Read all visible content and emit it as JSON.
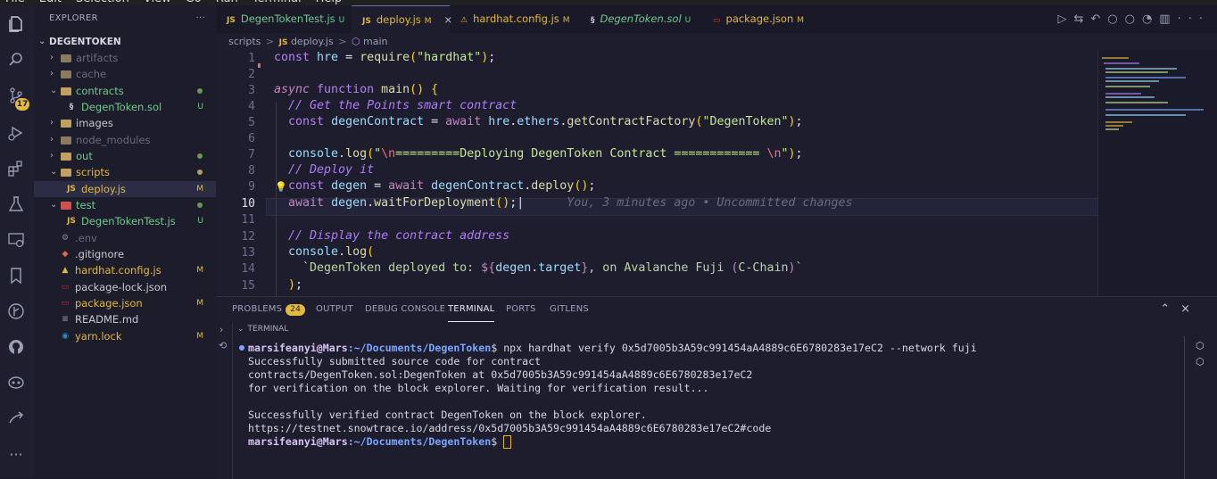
{
  "menu": [
    "File",
    "Edit",
    "Selection",
    "View",
    "Go",
    "Run",
    "Terminal",
    "Help"
  ],
  "activity": {
    "source_control_badge": "17",
    "icons": [
      "files-icon",
      "search-icon",
      "source-control-icon",
      "run-debug-icon",
      "extensions-icon",
      "testing-icon",
      "remote-explorer-icon",
      "bookmarks-icon",
      "gitlens-icon",
      "github-icon",
      "copilot-icon",
      "deploy-icon",
      "more-icon"
    ]
  },
  "explorer": {
    "title": "EXPLORER",
    "more": "···",
    "project": "DEGENTOKEN",
    "items": [
      {
        "label": "artifacts",
        "indent": 1,
        "type": "folder",
        "open": false,
        "status": "",
        "color": "#6b6b80"
      },
      {
        "label": "cache",
        "indent": 1,
        "type": "folder",
        "open": false,
        "status": "",
        "color": "#6b6b80"
      },
      {
        "label": "contracts",
        "indent": 1,
        "type": "folder",
        "open": true,
        "status": "dot",
        "color": "#73c991"
      },
      {
        "label": "DegenToken.sol",
        "indent": 2,
        "type": "sol",
        "status": "U",
        "color": "#73c991"
      },
      {
        "label": "images",
        "indent": 1,
        "type": "folder",
        "open": false,
        "status": "",
        "color": "#c8c8d0"
      },
      {
        "label": "node_modules",
        "indent": 1,
        "type": "folder",
        "open": false,
        "status": "",
        "color": "#6b6b80"
      },
      {
        "label": "out",
        "indent": 1,
        "type": "folder",
        "open": false,
        "status": "dot",
        "color": "#73c991"
      },
      {
        "label": "scripts",
        "indent": 1,
        "type": "folder",
        "open": true,
        "status": "dot",
        "color": "#e2b93d"
      },
      {
        "label": "deploy.js",
        "indent": 2,
        "type": "js",
        "status": "M",
        "color": "#e2b93d",
        "selected": true
      },
      {
        "label": "test",
        "indent": 1,
        "type": "folder",
        "open": true,
        "status": "dot",
        "color": "#73c991"
      },
      {
        "label": "DegenTokenTest.js",
        "indent": 2,
        "type": "js",
        "status": "U",
        "color": "#73c991"
      },
      {
        "label": ".env",
        "indent": 1,
        "type": "env",
        "status": "",
        "color": "#6b6b80"
      },
      {
        "label": ".gitignore",
        "indent": 1,
        "type": "git",
        "status": "",
        "color": "#c8c8d0"
      },
      {
        "label": "hardhat.config.js",
        "indent": 1,
        "type": "hardhat",
        "status": "M",
        "color": "#e2b93d"
      },
      {
        "label": "package-lock.json",
        "indent": 1,
        "type": "npm",
        "status": "",
        "color": "#c8c8d0"
      },
      {
        "label": "package.json",
        "indent": 1,
        "type": "npm",
        "status": "M",
        "color": "#e2b93d"
      },
      {
        "label": "README.md",
        "indent": 1,
        "type": "md",
        "status": "",
        "color": "#c8c8d0"
      },
      {
        "label": "yarn.lock",
        "indent": 1,
        "type": "yarn",
        "status": "M",
        "color": "#e2b93d"
      }
    ]
  },
  "tabs": [
    {
      "label": "DegenTokenTest.js",
      "status": "U",
      "icon": "JS",
      "color": "#73c991",
      "active": false
    },
    {
      "label": "deploy.js",
      "status": "M",
      "icon": "JS",
      "color": "#e2b93d",
      "active": true,
      "close": "×"
    },
    {
      "label": "hardhat.config.js",
      "status": "M",
      "icon": "⚠",
      "color": "#e2b93d",
      "active": false
    },
    {
      "label": "DegenToken.sol",
      "status": "U",
      "icon": "sol",
      "color": "#73c991",
      "active": false,
      "italic": true
    },
    {
      "label": "package.json",
      "status": "M",
      "icon": "npm",
      "color": "#e2b93d",
      "active": false
    }
  ],
  "breadcrumb": {
    "folder": "scripts",
    "file": "deploy.js",
    "symbol": "main",
    "sep": ">"
  },
  "editor": {
    "line_numbers": [
      "1",
      "2",
      "3",
      "4",
      "5",
      "6",
      "7",
      "8",
      "9",
      "10",
      "11",
      "12",
      "13",
      "14",
      "15"
    ],
    "current_line": "10",
    "blame": "You, 3 minutes ago • Uncommitted changes"
  },
  "panel": {
    "tabs": [
      "PROBLEMS",
      "OUTPUT",
      "DEBUG CONSOLE",
      "TERMINAL",
      "PORTS",
      "GITLENS"
    ],
    "problems_count": "24",
    "active_tab": "TERMINAL",
    "terminal_header": "TERMINAL",
    "prompt_user": "marsifeanyi@Mars",
    "prompt_path": ":~/Documents/DegenToken",
    "prompt_symbol": "$",
    "command": " npx hardhat verify 0x5d7005b3A59c991454aA4889c6E6780283e17eC2 --network fuji",
    "output": [
      "Successfully submitted source code for contract",
      "contracts/DegenToken.sol:DegenToken at 0x5d7005b3A59c991454aA4889c6E6780283e17eC2",
      "for verification on the block explorer. Waiting for verification result...",
      "",
      "Successfully verified contract DegenToken on the block explorer.",
      "https://testnet.snowtrace.io/address/0x5d7005b3A59c991454aA4889c6E6780283e17eC2#code"
    ]
  }
}
